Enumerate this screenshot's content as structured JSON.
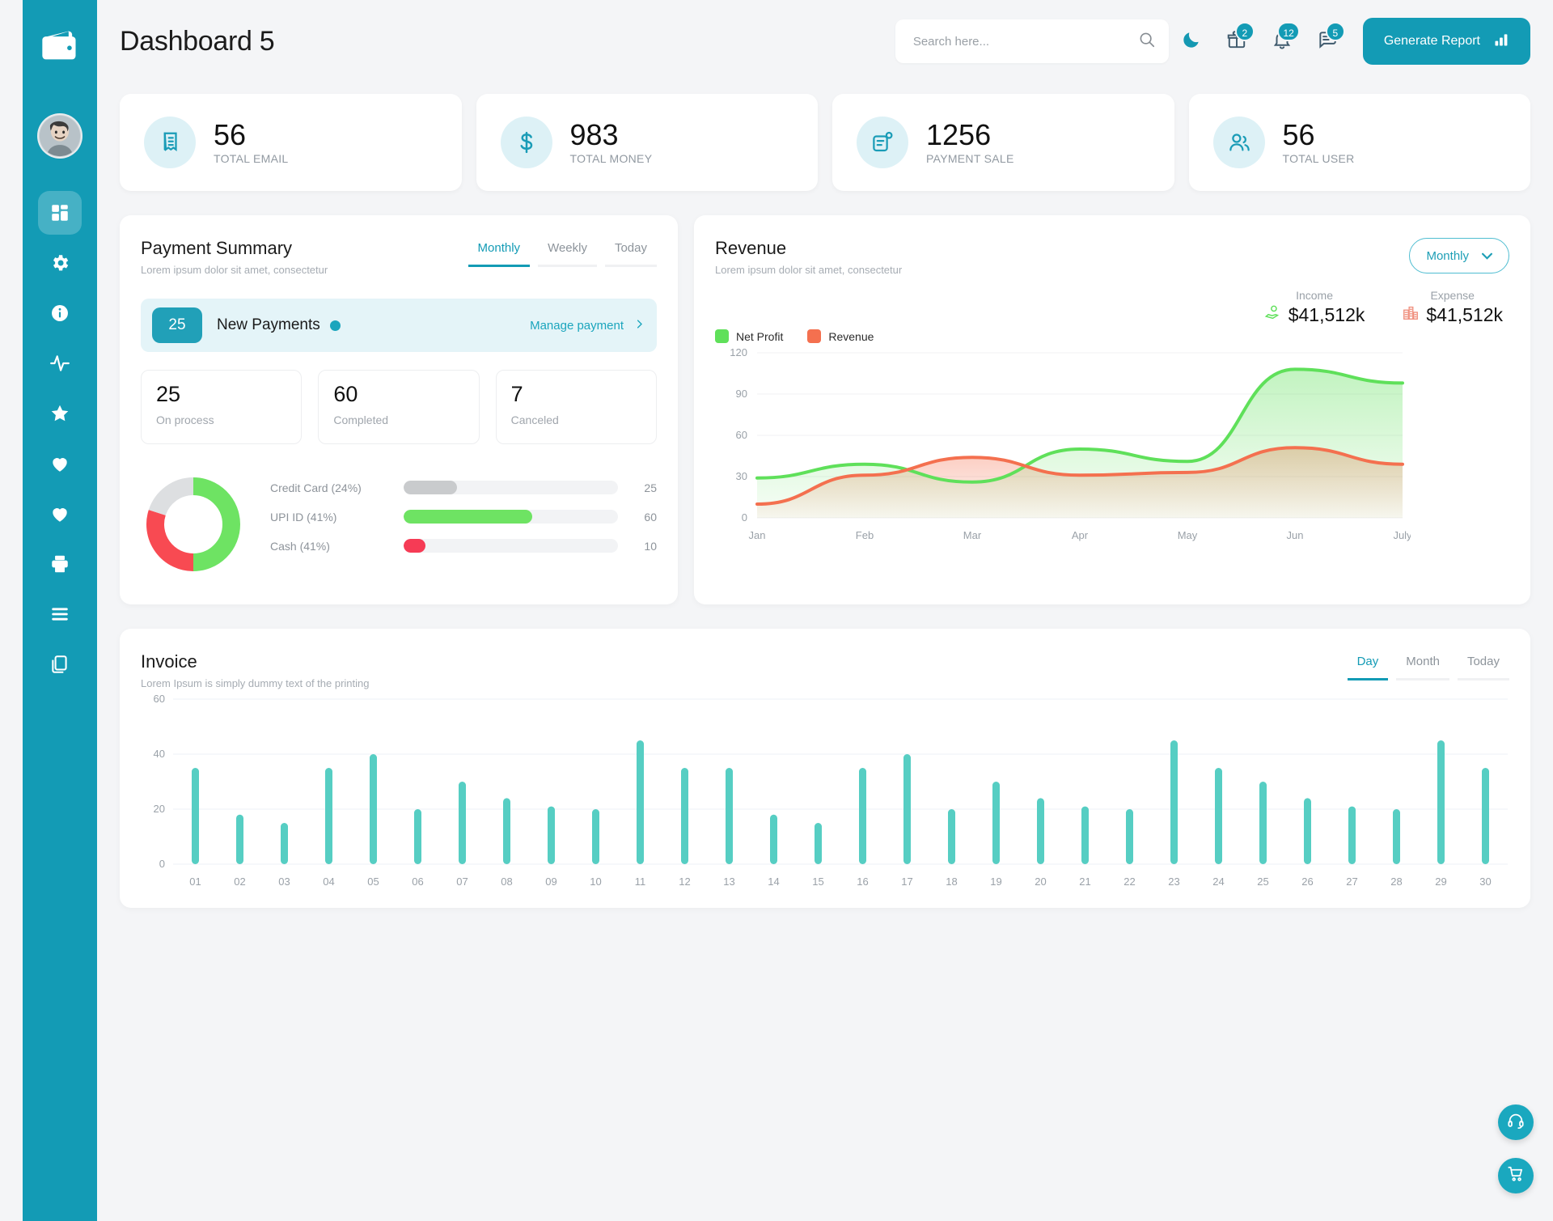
{
  "header": {
    "title": "Dashboard 5",
    "search_placeholder": "Search here...",
    "search_value": "",
    "generate_report_label": "Generate Report",
    "badges": {
      "gift": "2",
      "bell": "12",
      "chat": "5"
    }
  },
  "sidebar": {
    "items": [
      {
        "name": "dashboard",
        "icon": "grid-icon",
        "active": true
      },
      {
        "name": "settings",
        "icon": "gear-icon",
        "active": false
      },
      {
        "name": "info",
        "icon": "info-icon",
        "active": false
      },
      {
        "name": "analytics",
        "icon": "pulse-icon",
        "active": false
      },
      {
        "name": "favorites",
        "icon": "star-icon",
        "active": false
      },
      {
        "name": "likes",
        "icon": "heart-icon",
        "active": false
      },
      {
        "name": "saved",
        "icon": "heart-outline-icon",
        "active": false
      },
      {
        "name": "print",
        "icon": "printer-icon",
        "active": false
      },
      {
        "name": "list",
        "icon": "list-icon",
        "active": false
      },
      {
        "name": "files",
        "icon": "files-icon",
        "active": false
      }
    ]
  },
  "stats": [
    {
      "value": "56",
      "label": "TOTAL EMAIL",
      "icon": "receipt-icon"
    },
    {
      "value": "983",
      "label": "TOTAL MONEY",
      "icon": "dollar-icon"
    },
    {
      "value": "1256",
      "label": "PAYMENT SALE",
      "icon": "note-icon"
    },
    {
      "value": "56",
      "label": "TOTAL USER",
      "icon": "users-icon"
    }
  ],
  "payment_summary": {
    "title": "Payment Summary",
    "subtitle": "Lorem ipsum dolor sit amet, consectetur",
    "tabs": [
      {
        "label": "Monthly",
        "active": true
      },
      {
        "label": "Weekly",
        "active": false
      },
      {
        "label": "Today",
        "active": false
      }
    ],
    "banner": {
      "count": "25",
      "label": "New Payments",
      "action": "Manage payment"
    },
    "mini_stats": [
      {
        "value": "25",
        "label": "On process"
      },
      {
        "value": "60",
        "label": "Completed"
      },
      {
        "value": "7",
        "label": "Canceled"
      }
    ],
    "chart_data": {
      "type": "pie",
      "title": "Payment method distribution",
      "labels": [
        "Credit Card (24%)",
        "UPI ID (41%)",
        "Cash (41%)"
      ],
      "values": [
        25,
        60,
        10
      ],
      "percentages": [
        24,
        41,
        41
      ],
      "colors": [
        "#c9cbcd",
        "#6ee363",
        "#f63b55"
      ],
      "donut_segments": [
        {
          "label": "UPI ID",
          "color": "#6ee363",
          "percent": 50
        },
        {
          "label": "Cash",
          "color": "#f84a52",
          "percent": 30
        },
        {
          "label": "Credit Card",
          "color": "#dddfe1",
          "percent": 20
        }
      ],
      "bar_max": 100,
      "legend_position": "right"
    }
  },
  "revenue": {
    "title": "Revenue",
    "subtitle": "Lorem ipsum dolor sit amet, consectetur",
    "select_label": "Monthly",
    "income": {
      "label": "Income",
      "value": "$41,512k",
      "icon": "money-hand-icon"
    },
    "expense": {
      "label": "Expense",
      "value": "$41,512k",
      "icon": "buildings-icon"
    },
    "chart_data": {
      "type": "area",
      "title": "Revenue",
      "categories": [
        "Jan",
        "Feb",
        "Mar",
        "Apr",
        "May",
        "Jun",
        "July"
      ],
      "series": [
        {
          "name": "Net Profit",
          "color": "#5fe05a",
          "values": [
            29,
            39,
            26,
            50,
            41,
            108,
            98
          ]
        },
        {
          "name": "Revenue",
          "color": "#f4704f",
          "values": [
            10,
            31,
            44,
            31,
            33,
            51,
            39
          ]
        }
      ],
      "ylim": [
        0,
        120
      ],
      "yticks": [
        0,
        30,
        60,
        90,
        120
      ],
      "xlabel": "",
      "ylabel": "",
      "grid": true,
      "legend_position": "top-left"
    }
  },
  "invoice": {
    "title": "Invoice",
    "subtitle": "Lorem Ipsum is simply dummy text of the printing",
    "tabs": [
      {
        "label": "Day",
        "active": true
      },
      {
        "label": "Month",
        "active": false
      },
      {
        "label": "Today",
        "active": false
      }
    ],
    "chart_data": {
      "type": "bar",
      "title": "Invoice",
      "categories": [
        "01",
        "02",
        "03",
        "04",
        "05",
        "06",
        "07",
        "08",
        "09",
        "10",
        "11",
        "12",
        "13",
        "14",
        "15",
        "16",
        "17",
        "18",
        "19",
        "20",
        "21",
        "22",
        "23",
        "24",
        "25",
        "26",
        "27",
        "28",
        "29",
        "30"
      ],
      "values": [
        35,
        18,
        15,
        35,
        40,
        20,
        30,
        24,
        21,
        20,
        45,
        35,
        35,
        18,
        15,
        35,
        40,
        20,
        30,
        24,
        21,
        20,
        45,
        35,
        30,
        24,
        21,
        20,
        45,
        35
      ],
      "ylim": [
        0,
        60
      ],
      "yticks": [
        0,
        20,
        40,
        60
      ],
      "color": "#56cec3",
      "xlabel": "",
      "ylabel": "",
      "grid": true
    }
  },
  "floating": {
    "support_label": "support",
    "cart_label": "cart"
  },
  "colors": {
    "brand": "#139bb5",
    "green": "#5fe05a",
    "orange": "#f4704f",
    "teal_bar": "#56cec3",
    "red": "#f84a52"
  }
}
